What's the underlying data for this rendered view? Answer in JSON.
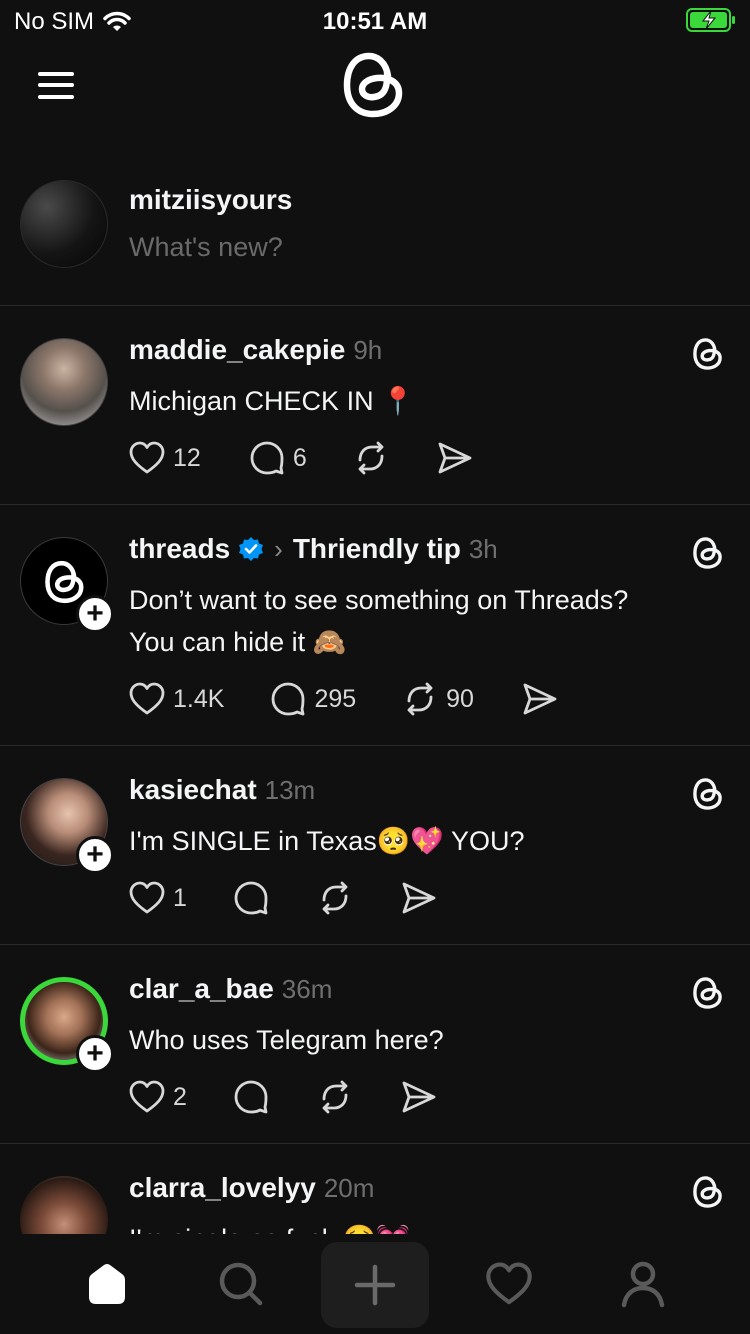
{
  "status_bar": {
    "carrier": "No SIM",
    "time": "10:51 AM"
  },
  "composer": {
    "username": "mitziisyours",
    "placeholder": "What's new?"
  },
  "posts": [
    {
      "username": "maddie_cakepie",
      "time": "9h",
      "text": "Michigan CHECK IN 📍",
      "likes": "12",
      "replies": "6",
      "reposts": ""
    },
    {
      "username": "threads",
      "verified": true,
      "topic": "Thriendly tip",
      "time": "3h",
      "text_line1": "Don’t want to see something on Threads?",
      "text_line2": "You can hide it 🙈",
      "likes": "1.4K",
      "replies": "295",
      "reposts": "90"
    },
    {
      "username": "kasiechat",
      "time": "13m",
      "text": "I'm SINGLE in Texas🥺💖 YOU?",
      "likes": "1",
      "replies": "",
      "reposts": ""
    },
    {
      "username": "clar_a_bae",
      "time": "36m",
      "text": "Who uses Telegram here?",
      "likes": "2",
      "replies": "",
      "reposts": ""
    },
    {
      "username": "clarra_lovelyy",
      "time": "20m",
      "text": "I'm single as fuck 🥺💓"
    }
  ],
  "tab_bar": {
    "items": [
      "home-icon",
      "search-icon",
      "create-icon",
      "activity-icon",
      "profile-icon"
    ],
    "active": "home-icon"
  },
  "colors": {
    "background": "#101010",
    "text": "#f3f5f7",
    "muted": "#6f6f6f",
    "verified": "#0095f6",
    "story_ring": "#3ad83a"
  }
}
